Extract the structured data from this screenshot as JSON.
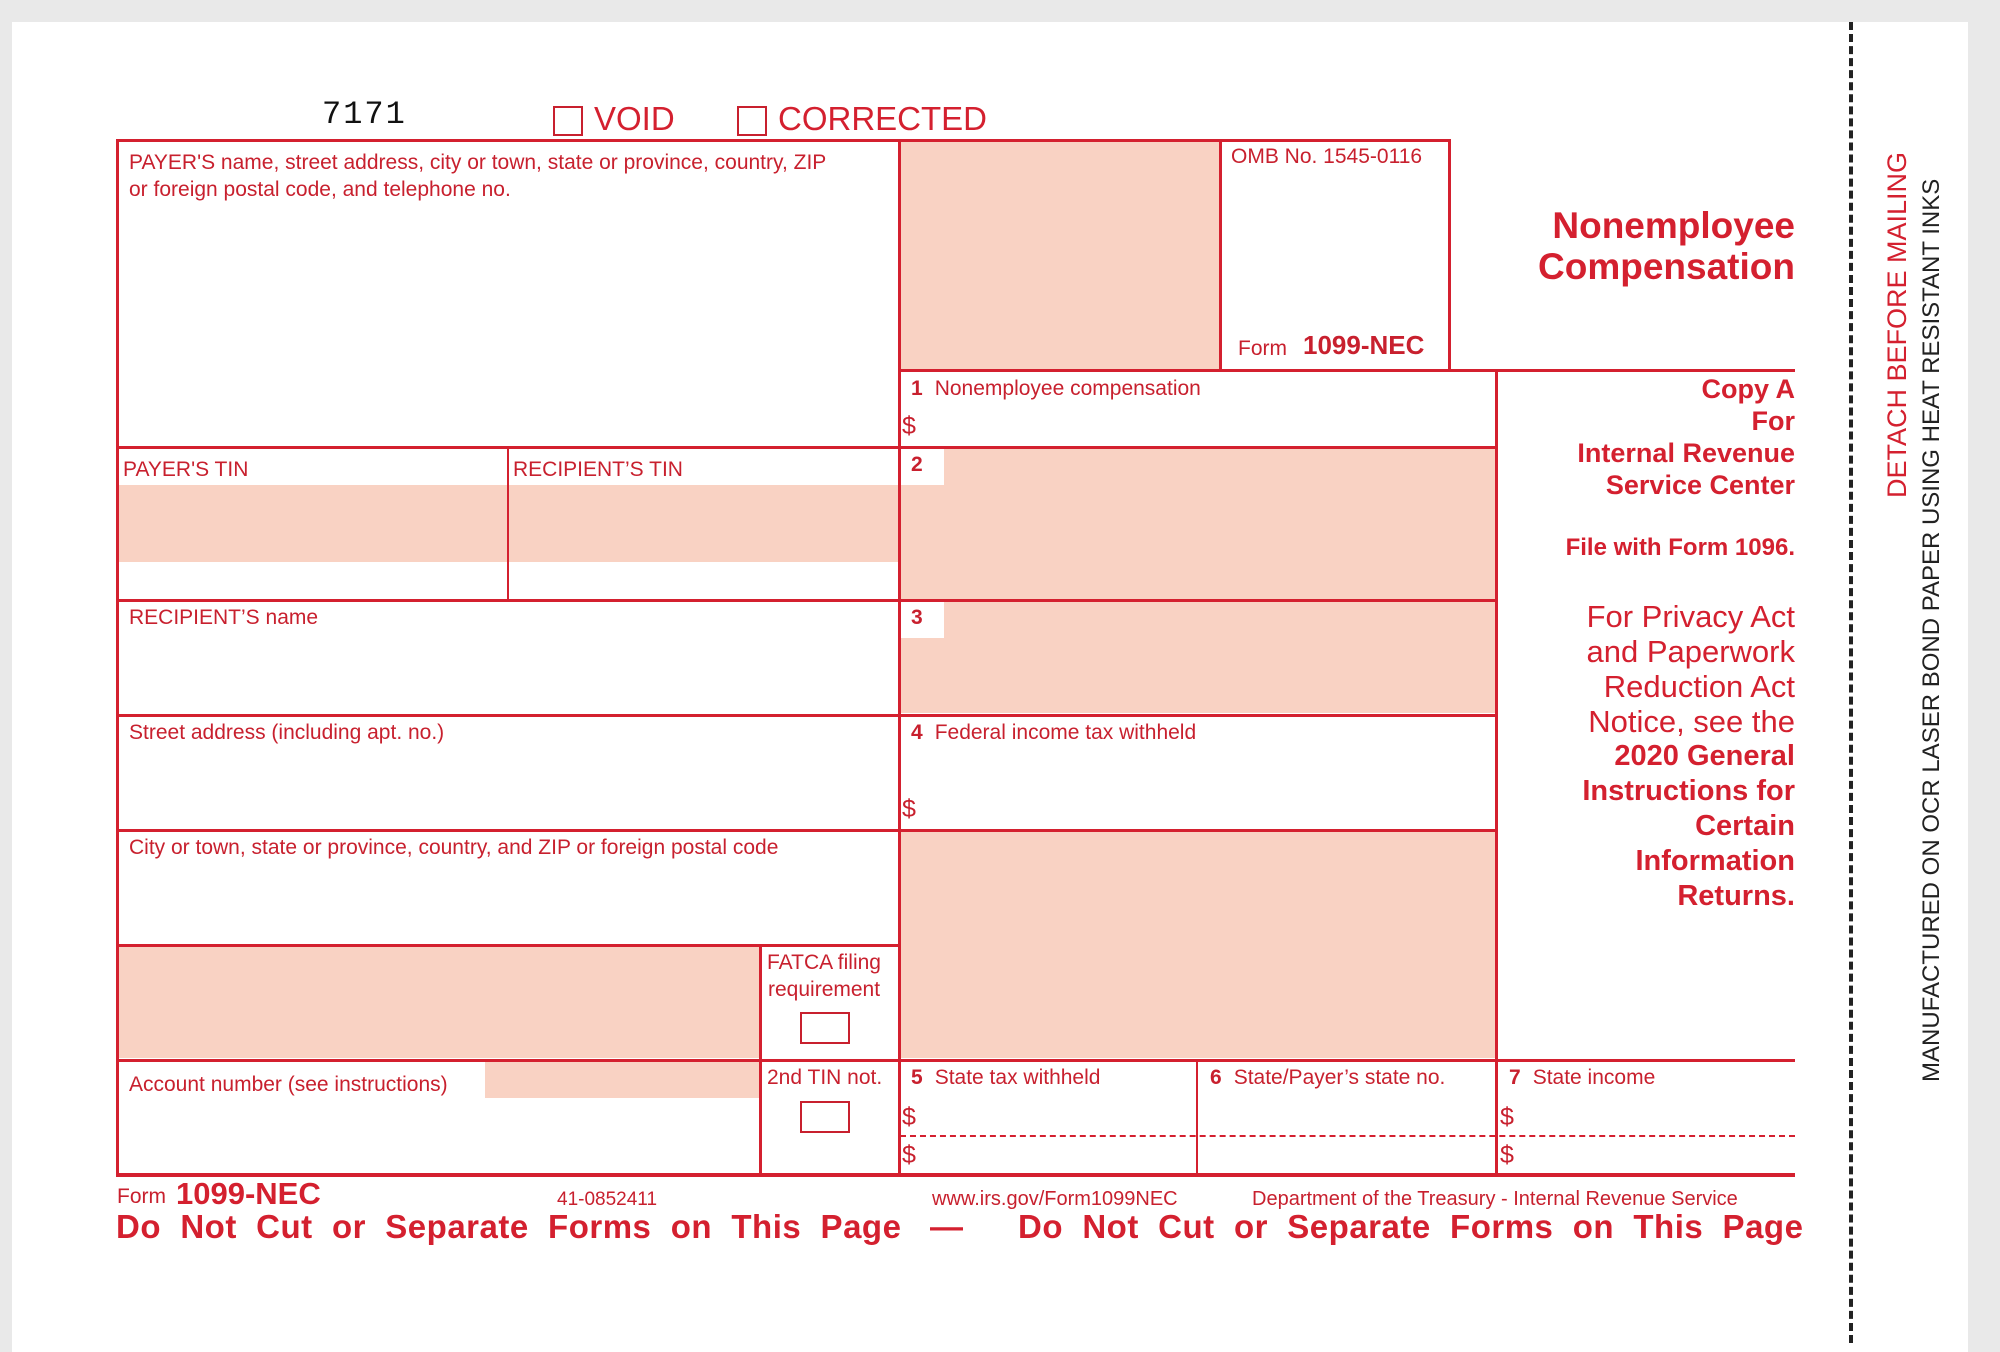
{
  "form_code": "7171",
  "checkboxes": {
    "void_label": "VOID",
    "corrected_label": "CORRECTED"
  },
  "payer_block": {
    "label_line1": "PAYER'S name, street address, city or town, state or province, country, ZIP",
    "label_line2": "or foreign postal code, and telephone no."
  },
  "omb": {
    "omb_number": "OMB No. 1545-0116",
    "form_word": "Form",
    "form_name": "1099-NEC"
  },
  "title": {
    "line1": "Nonemployee",
    "line2": "Compensation"
  },
  "copy_info": {
    "copy": "Copy A",
    "for": "For",
    "agency_line1": "Internal Revenue",
    "agency_line2": "Service Center",
    "file_with": "File with Form 1096.",
    "privacy_lines": [
      "For Privacy Act",
      "and Paperwork",
      "Reduction Act",
      "Notice, see the"
    ],
    "instructions_lines": [
      "2020 General",
      "Instructions for",
      "Certain",
      "Information",
      "Returns."
    ]
  },
  "boxes": {
    "box1": {
      "number": "1",
      "label": "Nonemployee compensation",
      "currency": "$",
      "value": ""
    },
    "box2": {
      "number": "2"
    },
    "box3": {
      "number": "3"
    },
    "box4": {
      "number": "4",
      "label": "Federal income tax withheld",
      "currency": "$",
      "value": ""
    },
    "box5": {
      "number": "5",
      "label": "State tax withheld",
      "currency": "$"
    },
    "box6": {
      "number": "6",
      "label": "State/Payer’s state no."
    },
    "box7": {
      "number": "7",
      "label": "State income",
      "currency": "$"
    }
  },
  "fields": {
    "payer_tin": "PAYER'S TIN",
    "recipient_tin": "RECIPIENT’S TIN",
    "recipient_name": "RECIPIENT’S name",
    "street_address": "Street address (including apt. no.)",
    "city_line": "City or town, state or province, country, and ZIP or foreign postal code",
    "fatca_line1": "FATCA filing",
    "fatca_line2": "requirement",
    "account_number": "Account number (see instructions)",
    "second_tin": "2nd TIN not."
  },
  "footer": {
    "form_word": "Form",
    "form_name": "1099-NEC",
    "catalog_number": "41-0852411",
    "url": "www.irs.gov/Form1099NEC",
    "department": "Department of the Treasury - Internal Revenue Service",
    "warning_left": "Do  Not  Cut  or  Separate  Forms  on  This  Page",
    "separator": "—",
    "warning_right": "Do  Not  Cut  or  Separate  Forms  on  This  Page"
  },
  "margin_text": {
    "detach": "DETACH BEFORE MAILING",
    "manufactured": "MANUFACTURED ON OCR LASER BOND PAPER USING HEAT RESISTANT INKS"
  },
  "colors": {
    "form_red": "#d4202f",
    "shade": "#f9d2c3"
  }
}
